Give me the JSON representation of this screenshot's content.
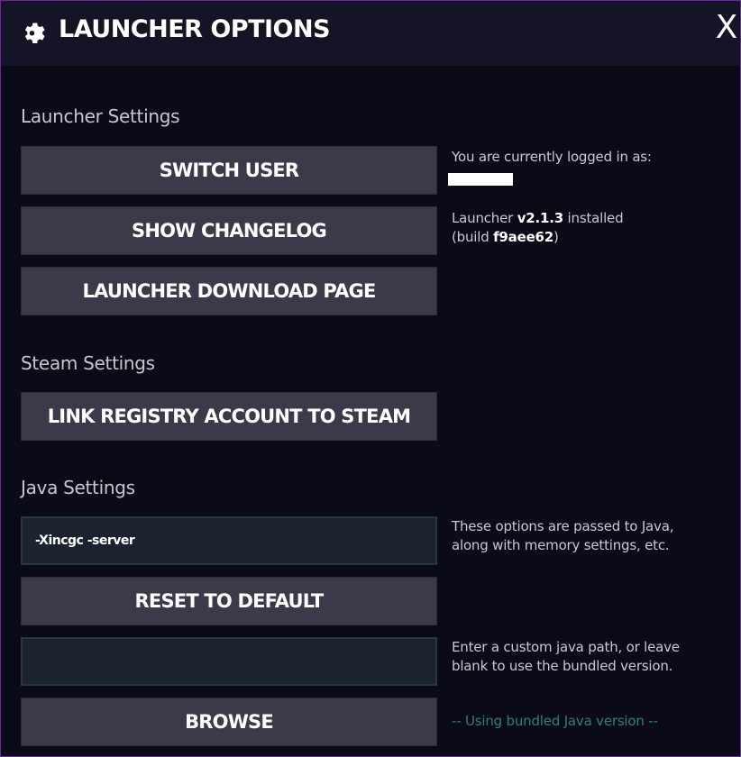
{
  "window": {
    "title": "LAUNCHER OPTIONS",
    "close_label": "X"
  },
  "launcher_settings": {
    "heading": "Launcher Settings",
    "switch_user": "SWITCH USER",
    "show_changelog": "SHOW CHANGELOG",
    "download_page": "LAUNCHER DOWNLOAD PAGE",
    "logged_in_text": "You are currently logged in as:",
    "version_prefix": "Launcher ",
    "version": "v2.1.3",
    "version_suffix": " installed",
    "build_prefix": "(build ",
    "build": "f9aee62",
    "build_suffix": ")"
  },
  "steam_settings": {
    "heading": "Steam Settings",
    "link_button": "LINK REGISTRY ACCOUNT TO STEAM"
  },
  "java_settings": {
    "heading": "Java Settings",
    "options_value": "-Xincgc -server",
    "options_note_line1": "These options are passed to Java,",
    "options_note_line2": "along with memory settings, etc.",
    "reset_button": "RESET TO DEFAULT",
    "path_value": "",
    "path_note_line1": "Enter a custom java path, or leave",
    "path_note_line2": "blank to use the bundled version.",
    "browse_button": "BROWSE",
    "bundled_status": "-- Using bundled Java version --"
  },
  "colors": {
    "background": "#0b0b18",
    "titlebar": "#141426",
    "button": "#3a3a4a",
    "border_accent": "#6a2aa8",
    "status_teal": "#2f7f7a"
  }
}
